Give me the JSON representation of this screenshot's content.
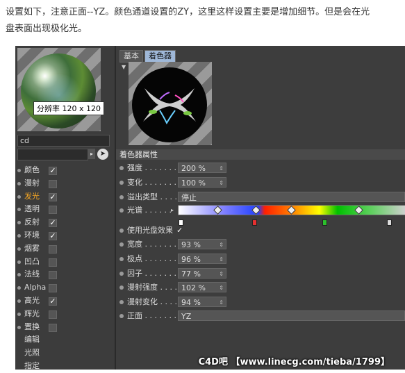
{
  "intro": {
    "line1": "设置如下，注意正面--YZ。颜色通道设置的ZY，这里这样设置主要是增加细节。但是会在光",
    "line2": "盘表面出现极化光。"
  },
  "left": {
    "tooltip": "分辨率 120 x 120",
    "name_value": "cd",
    "channels": [
      {
        "label": "颜色",
        "checked": "✓"
      },
      {
        "label": "漫射",
        "checked": ""
      },
      {
        "label": "发光",
        "checked": "✓"
      },
      {
        "label": "透明",
        "checked": ""
      },
      {
        "label": "反射",
        "checked": "✓"
      },
      {
        "label": "环境",
        "checked": "✓"
      },
      {
        "label": "烟雾",
        "checked": ""
      },
      {
        "label": "凹凸",
        "checked": ""
      },
      {
        "label": "法线",
        "checked": ""
      },
      {
        "label": "Alpha",
        "checked": ""
      },
      {
        "label": "高光",
        "checked": "✓"
      },
      {
        "label": "辉光",
        "checked": ""
      },
      {
        "label": "置换",
        "checked": ""
      },
      {
        "label": "编辑",
        "checked": ""
      },
      {
        "label": "光照",
        "checked": ""
      },
      {
        "label": "指定",
        "checked": ""
      }
    ]
  },
  "right": {
    "tabs": [
      "基本",
      "着色器"
    ],
    "section_title": "着色器属性",
    "props": {
      "strength": {
        "label": "强度 . . . . . . .",
        "value": "200 %"
      },
      "change": {
        "label": "变化 . . . . . . .",
        "value": "100 %"
      },
      "overflow": {
        "label": "溢出类型 . . . .",
        "value": "停止"
      },
      "spectrum": {
        "label": "光谱 . . . . . ."
      },
      "use_disc": {
        "label": "使用光盘效果",
        "value": "✓"
      },
      "width": {
        "label": "宽度 . . . . . . .",
        "value": "93 %"
      },
      "pole": {
        "label": "极点 . . . . . . .",
        "value": "96 %"
      },
      "factor": {
        "label": "因子 . . . . . . .",
        "value": "77 %"
      },
      "diffuse_strength": {
        "label": "漫射强度 . . . .",
        "value": "102 %"
      },
      "diffuse_change": {
        "label": "漫射变化 . . . .",
        "value": "94 %"
      },
      "front": {
        "label": "正面 . . . . . . .",
        "value": "YZ"
      }
    }
  },
  "watermark": "C4D吧 【www.linecg.com/tieba/1799】",
  "colors": {
    "active_channel": "#f5a623",
    "selected_tab": "#9fb8d8",
    "panel_bg": "#3a3a3a"
  }
}
